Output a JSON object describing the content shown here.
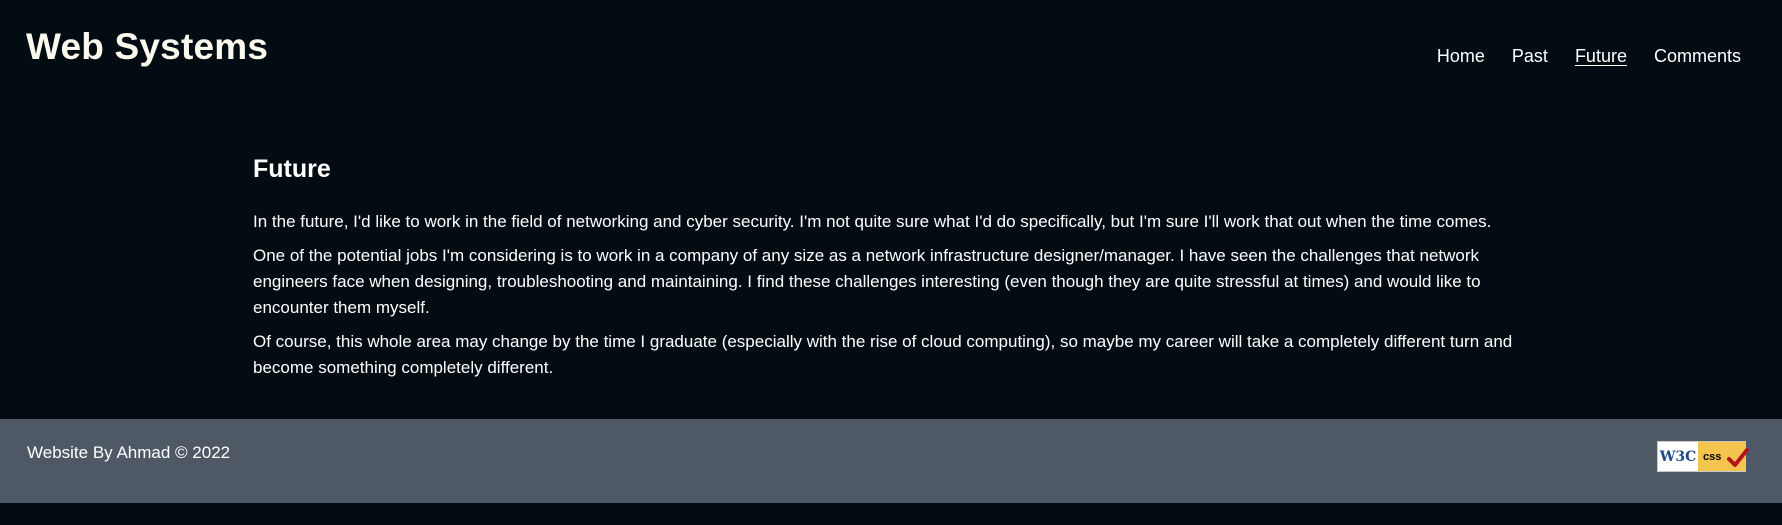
{
  "header": {
    "site_title": "Web Systems",
    "nav": [
      {
        "label": "Home",
        "active": false
      },
      {
        "label": "Past",
        "active": false
      },
      {
        "label": "Future",
        "active": true
      },
      {
        "label": "Comments",
        "active": false
      }
    ]
  },
  "main": {
    "heading": "Future",
    "paragraphs": [
      "In the future, I'd like to work in the field of networking and cyber security. I'm not quite sure what I'd do specifically, but I'm sure I'll work that out when the time comes.",
      "One of the potential jobs I'm considering is to work in a company of any size as a network infrastructure designer/manager. I have seen the challenges that network engineers face when designing, troubleshooting and maintaining. I find these challenges interesting (even though they are quite stressful at times) and would like to encounter them myself.",
      "Of course, this whole area may change by the time I graduate (especially with the rise of cloud computing), so maybe my career will take a completely different turn and become something completely different."
    ]
  },
  "footer": {
    "credit": "Website By Ahmad © 2022",
    "badge": {
      "left_text": "W3C",
      "right_text": "css",
      "icon": "checkmark-icon"
    }
  },
  "colors": {
    "background": "#020c12",
    "footer_bg": "#4f5965",
    "title": "#fbf8ee",
    "badge_yellow": "#f4c44e",
    "badge_blue": "#1c4a8a",
    "badge_check": "#b3141a"
  }
}
